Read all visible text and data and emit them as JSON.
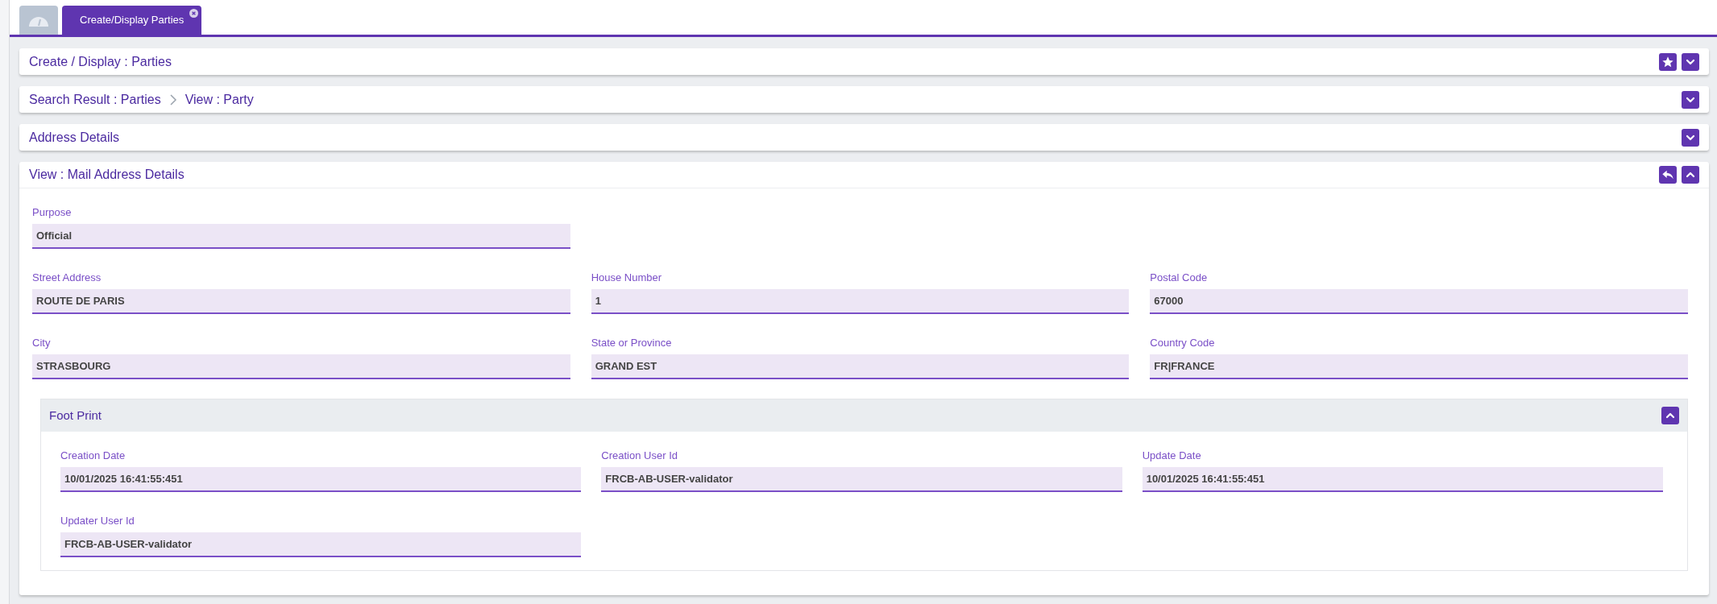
{
  "tabs": [
    {
      "kind": "dashboard",
      "selected": false
    },
    {
      "kind": "text",
      "label": "Create/Display Parties",
      "selected": true,
      "closable": true
    }
  ],
  "panels": [
    {
      "title": "Create / Display : Parties",
      "actions": [
        {
          "kind": "star"
        }
      ],
      "expanded": false
    },
    {
      "breadcrumb": [
        "Search Result : Parties",
        "View : Party"
      ],
      "expanded": false
    },
    {
      "title": "Address Details",
      "expanded": false
    },
    {
      "title": "View : Mail Address Details",
      "actions": [
        {
          "kind": "back"
        }
      ],
      "expanded": true,
      "rows": [
        [
          {
            "label": "Purpose",
            "value": "Official"
          }
        ],
        [
          {
            "label": "Street Address",
            "value": "ROUTE DE PARIS"
          },
          {
            "label": "House Number",
            "value": "1"
          },
          {
            "label": "Postal Code",
            "value": "67000"
          }
        ],
        [
          {
            "label": "City",
            "value": "STRASBOURG"
          },
          {
            "label": "State or Province",
            "value": "GRAND EST"
          },
          {
            "label": "Country Code",
            "value": "FR|FRANCE"
          }
        ]
      ],
      "subsection": {
        "title": "Foot Print",
        "expanded": true,
        "rows": [
          [
            {
              "label": "Creation Date",
              "value": "10/01/2025 16:41:55:451"
            },
            {
              "label": "Creation User Id",
              "value": "FRCB-AB-USER-validator"
            },
            {
              "label": "Update Date",
              "value": "10/01/2025 16:41:55:451"
            }
          ],
          [
            {
              "label": "Updater User Id",
              "value": "FRCB-AB-USER-validator"
            }
          ]
        ]
      }
    }
  ]
}
